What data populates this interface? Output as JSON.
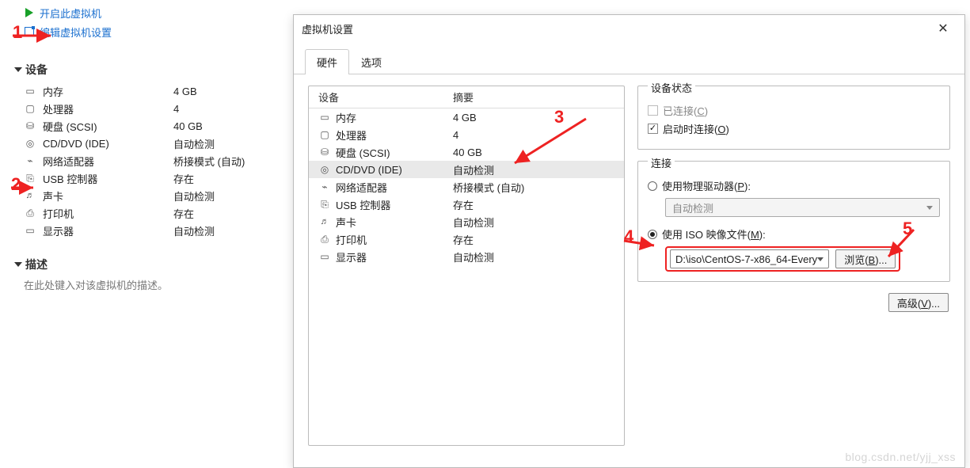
{
  "left_panel": {
    "actions": {
      "power_on": "开启此虚拟机",
      "edit_settings": "编辑虚拟机设置"
    },
    "section_devices": "设备",
    "devices": [
      {
        "icon": "i-mem",
        "name": "内存",
        "value": "4 GB"
      },
      {
        "icon": "i-cpu",
        "name": "处理器",
        "value": "4"
      },
      {
        "icon": "i-disk",
        "name": "硬盘 (SCSI)",
        "value": "40 GB"
      },
      {
        "icon": "i-cd",
        "name": "CD/DVD (IDE)",
        "value": "自动检测"
      },
      {
        "icon": "i-net",
        "name": "网络适配器",
        "value": "桥接模式 (自动)"
      },
      {
        "icon": "i-usb",
        "name": "USB 控制器",
        "value": "存在"
      },
      {
        "icon": "i-snd",
        "name": "声卡",
        "value": "自动检测"
      },
      {
        "icon": "i-prn",
        "name": "打印机",
        "value": "存在"
      },
      {
        "icon": "i-disp",
        "name": "显示器",
        "value": "自动检测"
      }
    ],
    "section_description": "描述",
    "description_placeholder": "在此处键入对该虚拟机的描述。"
  },
  "dialog": {
    "title": "虚拟机设置",
    "tabs": {
      "hardware": "硬件",
      "options": "选项"
    },
    "table_head": {
      "device": "设备",
      "summary": "摘要"
    },
    "rows": [
      {
        "icon": "i-mem",
        "name": "内存",
        "summary": "4 GB",
        "selected": false
      },
      {
        "icon": "i-cpu",
        "name": "处理器",
        "summary": "4",
        "selected": false
      },
      {
        "icon": "i-disk",
        "name": "硬盘 (SCSI)",
        "summary": "40 GB",
        "selected": false
      },
      {
        "icon": "i-cd",
        "name": "CD/DVD (IDE)",
        "summary": "自动检测",
        "selected": true
      },
      {
        "icon": "i-net",
        "name": "网络适配器",
        "summary": "桥接模式 (自动)",
        "selected": false
      },
      {
        "icon": "i-usb",
        "name": "USB 控制器",
        "summary": "存在",
        "selected": false
      },
      {
        "icon": "i-snd",
        "name": "声卡",
        "summary": "自动检测",
        "selected": false
      },
      {
        "icon": "i-prn",
        "name": "打印机",
        "summary": "存在",
        "selected": false
      },
      {
        "icon": "i-disp",
        "name": "显示器",
        "summary": "自动检测",
        "selected": false
      }
    ],
    "detail": {
      "status_legend": "设备状态",
      "connected_label": "已连接(",
      "connected_key": "C",
      "connect_at_poweron_label": "启动时连接(",
      "connect_at_poweron_key": "O",
      "close_paren": ")",
      "connection_legend": "连接",
      "use_physical_label": "使用物理驱动器(",
      "use_physical_key": "P",
      "physical_value": "自动检测",
      "use_iso_label": "使用 ISO 映像文件(",
      "use_iso_key": "M",
      "iso_path": "D:\\iso\\CentOS-7-x86_64-Every",
      "browse_label": "浏览(",
      "browse_key": "B",
      "browse_suffix": ")...",
      "advanced_label": "高级(",
      "advanced_key": "V",
      "advanced_suffix": ")...",
      "colon": "):"
    }
  },
  "annotations": {
    "n1": "1",
    "n2": "2",
    "n3": "3",
    "n4": "4",
    "n5": "5"
  },
  "watermark": "blog.csdn.net/yjj_xss"
}
